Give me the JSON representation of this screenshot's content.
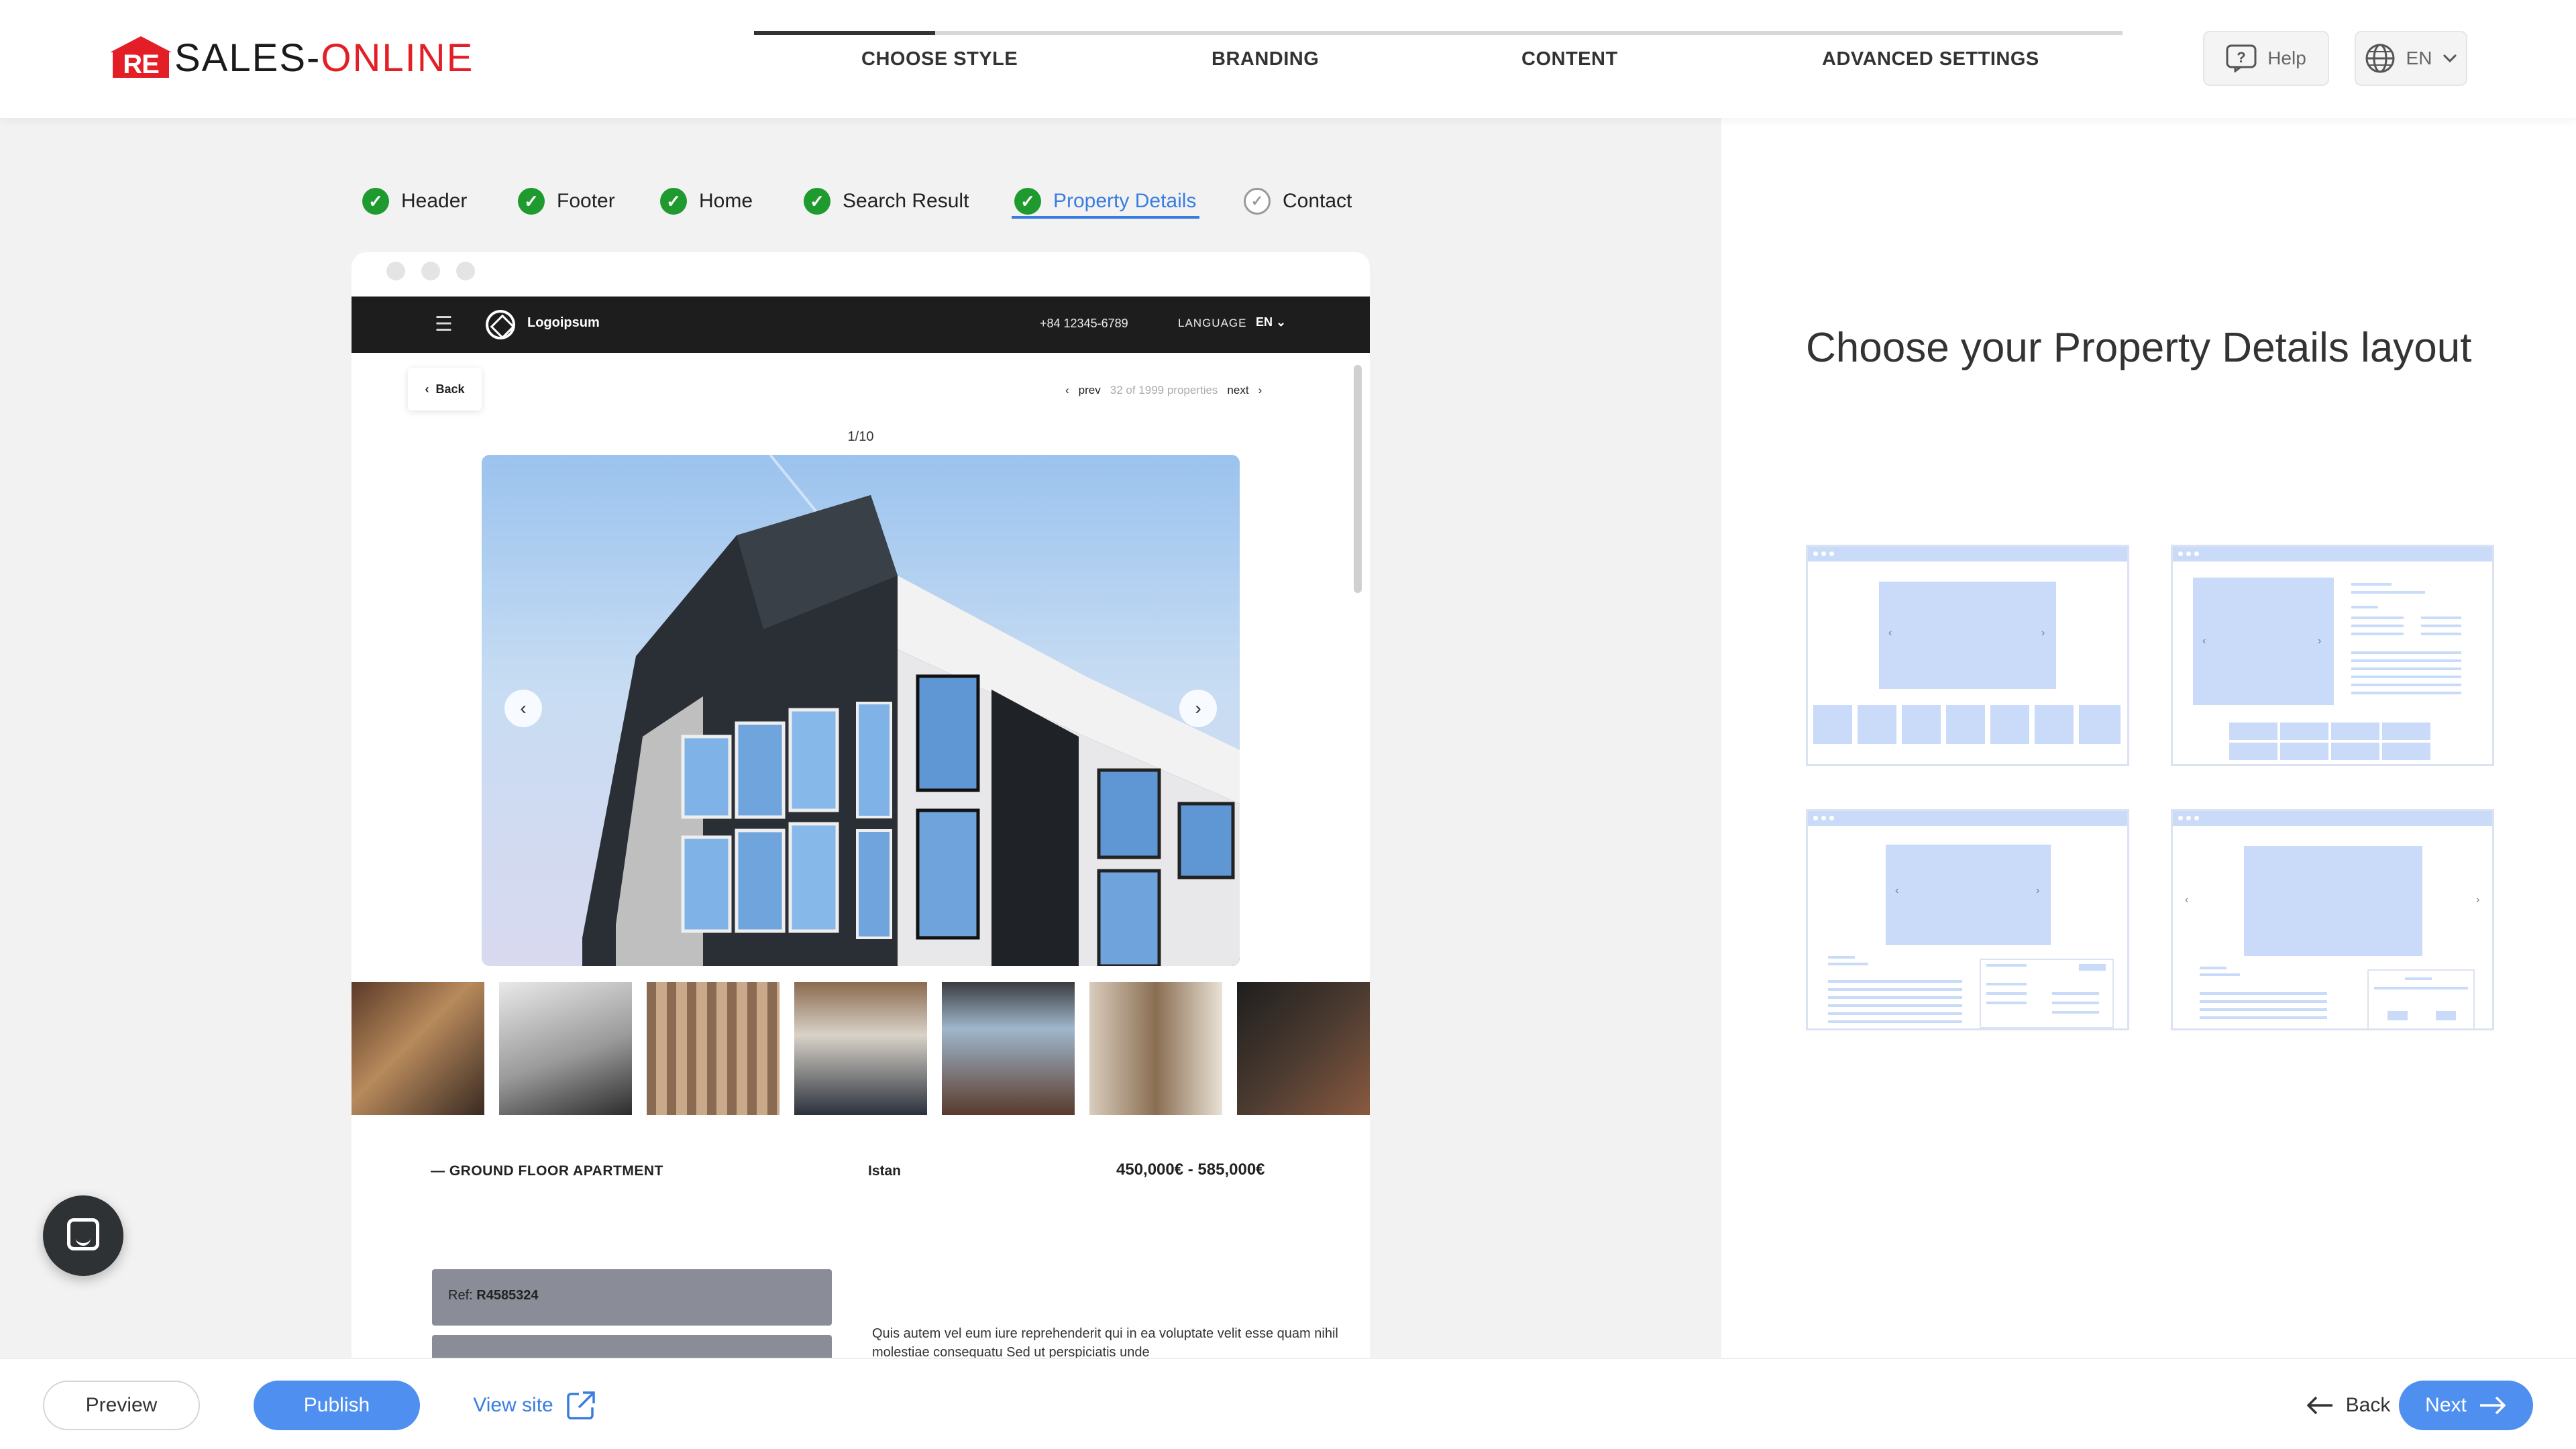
{
  "brand": {
    "logo_mark": "RE",
    "logo_main": "SALES-",
    "logo_accent": "ONLINE"
  },
  "steps": [
    {
      "label": "CHOOSE STYLE"
    },
    {
      "label": "BRANDING"
    },
    {
      "label": "CONTENT"
    },
    {
      "label": "ADVANCED SETTINGS"
    }
  ],
  "top_actions": {
    "help_label": "Help",
    "language": "EN"
  },
  "section_tabs": [
    {
      "label": "Header",
      "state": "done"
    },
    {
      "label": "Footer",
      "state": "done"
    },
    {
      "label": "Home",
      "state": "done"
    },
    {
      "label": "Search Result",
      "state": "done"
    },
    {
      "label": "Property Details",
      "state": "active"
    },
    {
      "label": "Contact",
      "state": "pending"
    }
  ],
  "preview": {
    "site_logo": "Logoipsum",
    "phone": "+84 12345-6789",
    "language_label": "LANGUAGE",
    "language_value": "EN",
    "back_label": "Back",
    "prev_label": "prev",
    "position_text": "32 of 1999 properties",
    "next_label": "next",
    "image_counter": "1/10",
    "property_type": "GROUND FLOOR APARTMENT",
    "location": "Istan",
    "price": "450,000€  -  585,000€",
    "ref_label": "Ref:",
    "ref_value": "R4585324",
    "description": "Quis autem vel eum iure reprehenderit qui in ea voluptate velit esse quam nihil molestiae consequatu Sed ut perspiciatis unde"
  },
  "right_panel": {
    "title": "Choose your Property Details layout",
    "layout_options": [
      "layout-1",
      "layout-2",
      "layout-3",
      "layout-4"
    ]
  },
  "footer": {
    "preview_label": "Preview",
    "publish_label": "Publish",
    "view_site_label": "View site",
    "back_label": "Back",
    "next_label": "Next"
  },
  "colors": {
    "accent": "#4f8fef",
    "brand_red": "#e41e26",
    "check_green": "#1f9a2e",
    "layout_tint": "#c9dbf8"
  },
  "icons": [
    "help-icon",
    "globe-icon",
    "chevron-down-icon",
    "check-icon",
    "menu-icon",
    "external-link-icon",
    "arrow-left-icon",
    "arrow-right-icon",
    "chat-icon"
  ]
}
